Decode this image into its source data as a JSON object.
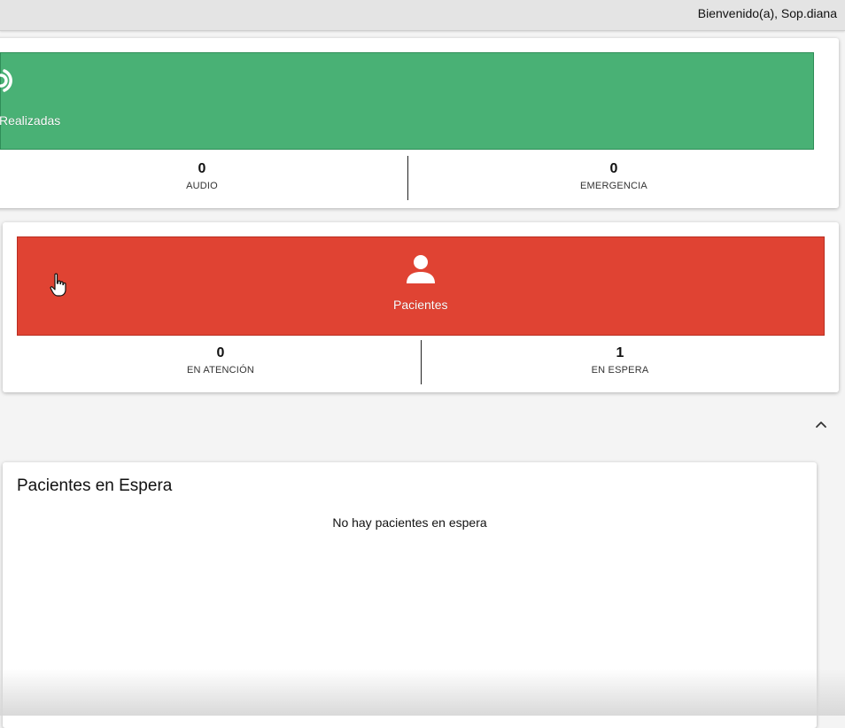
{
  "header": {
    "welcome": "Bienvenido(a), Sop.diana"
  },
  "calls_card": {
    "banner_label": "Realizadas",
    "banner_icon": "broadcast-icon",
    "banner_color": "#49b175",
    "stats": [
      {
        "value": "0",
        "label": "AUDIO"
      },
      {
        "value": "0",
        "label": "EMERGENCIA"
      }
    ]
  },
  "patients_card": {
    "banner_label": "Pacientes",
    "banner_icon": "person-icon",
    "banner_color": "#e04333",
    "stats": [
      {
        "value": "0",
        "label": "EN ATENCIÓN"
      },
      {
        "value": "1",
        "label": "EN ESPERA"
      }
    ]
  },
  "section": {
    "collapse_icon": "chevron-up-icon"
  },
  "waiting_list": {
    "title": "Pacientes en Espera",
    "empty_message": "No hay pacientes en espera"
  }
}
